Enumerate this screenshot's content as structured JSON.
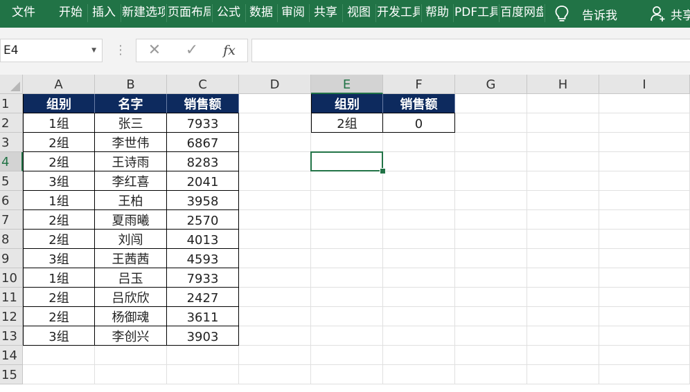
{
  "ribbon": {
    "tabs": [
      "文件",
      "开始",
      "插入",
      "新建选项卡",
      "页面布局",
      "公式",
      "数据",
      "审阅",
      "共享",
      "视图",
      "开发工具",
      "帮助",
      "PDF工具",
      "百度网盘"
    ],
    "tell_me": "告诉我",
    "share": "共享",
    "colors": {
      "ribbon_bg": "#217346"
    }
  },
  "formula_bar": {
    "name_box": "E4",
    "cancel_icon": "cancel-icon",
    "enter_icon": "check-icon",
    "fx_label": "fx",
    "formula": ""
  },
  "sheet": {
    "columns": [
      "A",
      "B",
      "C",
      "D",
      "E",
      "F",
      "G",
      "H",
      "I"
    ],
    "rows": [
      "1",
      "2",
      "3",
      "4",
      "5",
      "6",
      "7",
      "8",
      "9",
      "10",
      "11",
      "12",
      "13",
      "14",
      "15"
    ],
    "selected_cell": "E4",
    "header_color": "#0d2a5e",
    "table1": {
      "headers": [
        "组别",
        "名字",
        "销售额"
      ],
      "rows": [
        [
          "1组",
          "张三",
          "7933"
        ],
        [
          "2组",
          "李世伟",
          "6867"
        ],
        [
          "2组",
          "王诗雨",
          "8283"
        ],
        [
          "3组",
          "李红喜",
          "2041"
        ],
        [
          "1组",
          "王柏",
          "3958"
        ],
        [
          "2组",
          "夏雨曦",
          "2570"
        ],
        [
          "2组",
          "刘闯",
          "4013"
        ],
        [
          "3组",
          "王茜茜",
          "4593"
        ],
        [
          "1组",
          "吕玉",
          "7933"
        ],
        [
          "2组",
          "吕欣欣",
          "2427"
        ],
        [
          "2组",
          "杨御魂",
          "3611"
        ],
        [
          "3组",
          "李创兴",
          "3903"
        ]
      ]
    },
    "table2": {
      "headers": [
        "组别",
        "销售额"
      ],
      "rows": [
        [
          "2组",
          "0"
        ]
      ]
    }
  }
}
